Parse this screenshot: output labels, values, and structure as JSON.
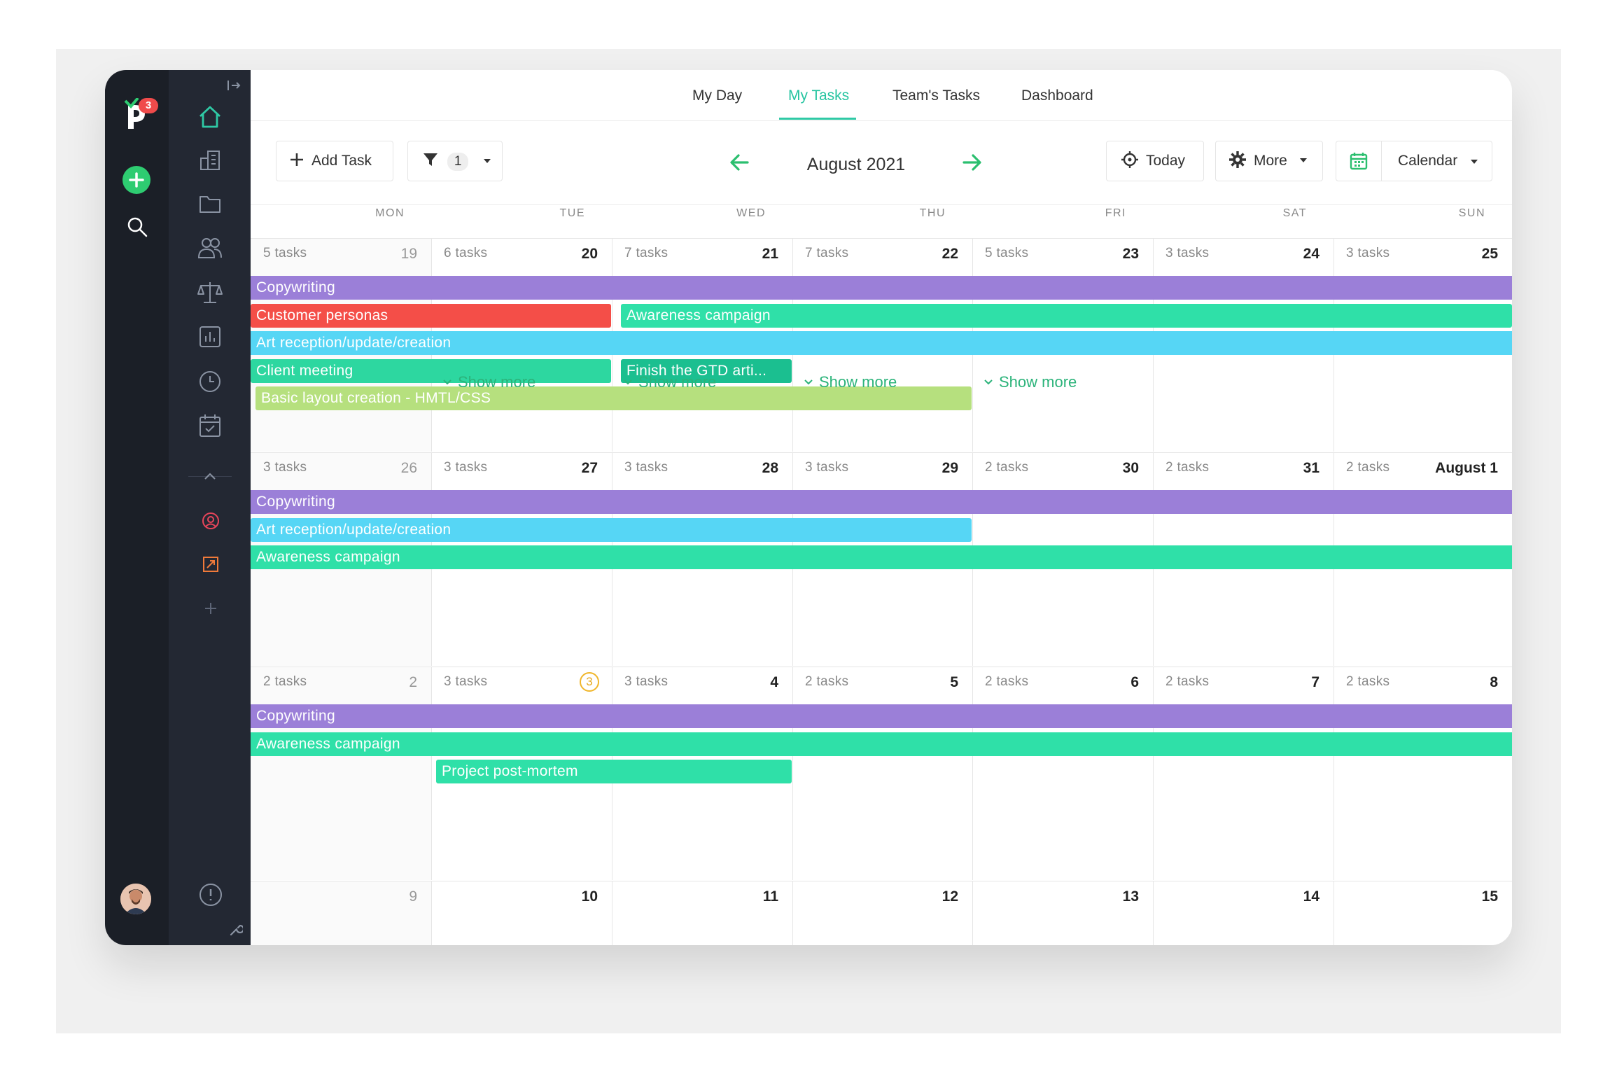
{
  "nav_tabs": [
    {
      "label": "My Day",
      "active": false
    },
    {
      "label": "My Tasks",
      "active": true
    },
    {
      "label": "Team's Tasks",
      "active": false
    },
    {
      "label": "Dashboard",
      "active": false
    }
  ],
  "rail": {
    "notification_count": "3"
  },
  "toolbar": {
    "add_task_label": "Add Task",
    "filter_count": "1",
    "month_label": "August 2021",
    "today_label": "Today",
    "more_label": "More",
    "view_label": "Calendar"
  },
  "weekdays": [
    "MON",
    "TUE",
    "WED",
    "THU",
    "FRI",
    "SAT",
    "SUN"
  ],
  "weeks": [
    {
      "days": [
        {
          "tasks": "5 tasks",
          "num": "19",
          "muted": true
        },
        {
          "tasks": "6 tasks",
          "num": "20"
        },
        {
          "tasks": "7 tasks",
          "num": "21"
        },
        {
          "tasks": "7 tasks",
          "num": "22"
        },
        {
          "tasks": "5 tasks",
          "num": "23"
        },
        {
          "tasks": "3 tasks",
          "num": "24"
        },
        {
          "tasks": "3 tasks",
          "num": "25"
        }
      ],
      "bars": [
        {
          "label": "Copywriting",
          "color": "#9b7fd8"
        },
        {
          "label": "Customer personas",
          "color": "#f44e48"
        },
        {
          "label": "Awareness campaign",
          "color": "#2fe0a8"
        },
        {
          "label": "Art reception/update/creation",
          "color": "#56d6f5"
        },
        {
          "label": "Client meeting",
          "color": "#2dd7a0"
        },
        {
          "label": "Finish the GTD arti...",
          "color": "#1bbf90"
        },
        {
          "label": "Basic layout creation - HMTL/CSS",
          "color": "#b6e07e"
        }
      ],
      "show_more": [
        "Show more",
        "Show more",
        "Show more",
        "Show more"
      ]
    },
    {
      "days": [
        {
          "tasks": "3 tasks",
          "num": "26",
          "muted": true
        },
        {
          "tasks": "3 tasks",
          "num": "27"
        },
        {
          "tasks": "3 tasks",
          "num": "28"
        },
        {
          "tasks": "3 tasks",
          "num": "29"
        },
        {
          "tasks": "2 tasks",
          "num": "30"
        },
        {
          "tasks": "2 tasks",
          "num": "31"
        },
        {
          "tasks": "2 tasks",
          "num": "August 1"
        }
      ],
      "bars": [
        {
          "label": "Copywriting",
          "color": "#9b7fd8"
        },
        {
          "label": "Art reception/update/creation",
          "color": "#56d6f5"
        },
        {
          "label": "Awareness campaign",
          "color": "#2fe0a8"
        }
      ]
    },
    {
      "days": [
        {
          "tasks": "2 tasks",
          "num": "2",
          "muted": true
        },
        {
          "tasks": "3 tasks",
          "num": "3",
          "today": true
        },
        {
          "tasks": "3 tasks",
          "num": "4"
        },
        {
          "tasks": "2 tasks",
          "num": "5"
        },
        {
          "tasks": "2 tasks",
          "num": "6"
        },
        {
          "tasks": "2 tasks",
          "num": "7"
        },
        {
          "tasks": "2 tasks",
          "num": "8"
        }
      ],
      "bars": [
        {
          "label": "Copywriting",
          "color": "#9b7fd8"
        },
        {
          "label": "Awareness campaign",
          "color": "#2fe0a8"
        },
        {
          "label": "Project post-mortem",
          "color": "#2fe0a8"
        }
      ]
    },
    {
      "days": [
        {
          "num": "9",
          "muted": true
        },
        {
          "num": "10"
        },
        {
          "num": "11"
        },
        {
          "num": "12"
        },
        {
          "num": "13"
        },
        {
          "num": "14"
        },
        {
          "num": "15"
        }
      ]
    }
  ],
  "colors": {
    "accent": "#2fc9a5",
    "rail_bg": "#1b1f27",
    "sidebar_bg": "#232833"
  }
}
